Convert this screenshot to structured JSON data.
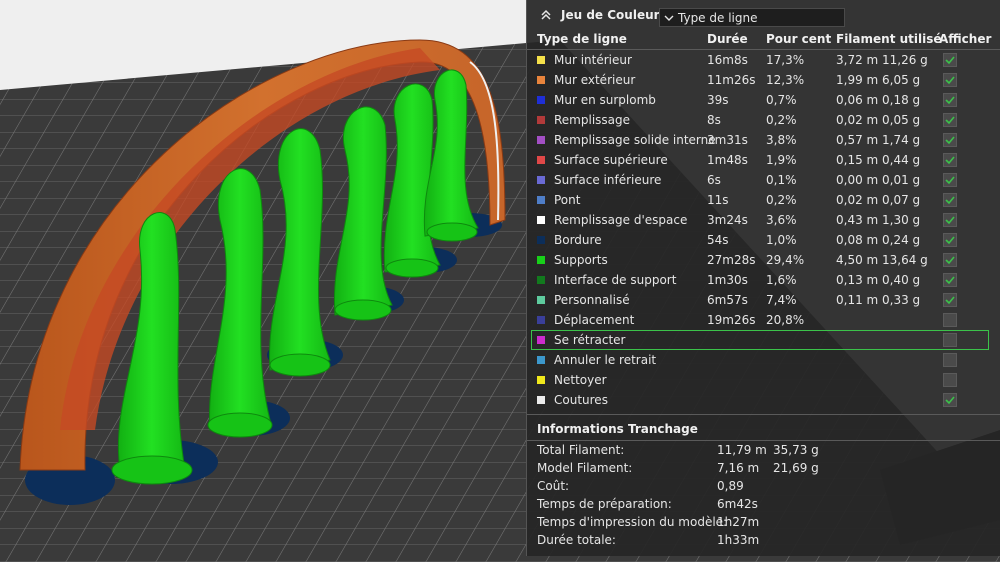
{
  "panel": {
    "title": "Jeu de Couleur",
    "select_value": "Type de ligne"
  },
  "columns": {
    "type": "Type de ligne",
    "duration": "Durée",
    "percent": "Pour cent",
    "filament": "Filament utilisé",
    "show": "Afficher"
  },
  "rows": [
    {
      "name": "Mur intérieur",
      "color": "#f5e04a",
      "duration": "16m8s",
      "percent": "17,3%",
      "length": "3,72 m",
      "weight": "11,26 g",
      "show": true
    },
    {
      "name": "Mur extérieur",
      "color": "#e8843c",
      "duration": "11m26s",
      "percent": "12,3%",
      "length": "1,99 m",
      "weight": "6,05 g",
      "show": true
    },
    {
      "name": "Mur en surplomb",
      "color": "#1f2fd6",
      "duration": "39s",
      "percent": "0,7%",
      "length": "0,06 m",
      "weight": "0,18 g",
      "show": true
    },
    {
      "name": "Remplissage",
      "color": "#b23a3a",
      "duration": "8s",
      "percent": "0,2%",
      "length": "0,02 m",
      "weight": "0,05 g",
      "show": true
    },
    {
      "name": "Remplissage solide interne",
      "color": "#a34fc4",
      "duration": "3m31s",
      "percent": "3,8%",
      "length": "0,57 m",
      "weight": "1,74 g",
      "show": true
    },
    {
      "name": "Surface supérieure",
      "color": "#e04848",
      "duration": "1m48s",
      "percent": "1,9%",
      "length": "0,15 m",
      "weight": "0,44 g",
      "show": true
    },
    {
      "name": "Surface inférieure",
      "color": "#6a6ad4",
      "duration": "6s",
      "percent": "0,1%",
      "length": "0,00 m",
      "weight": "0,01 g",
      "show": true
    },
    {
      "name": "Pont",
      "color": "#4f7ec8",
      "duration": "11s",
      "percent": "0,2%",
      "length": "0,02 m",
      "weight": "0,07 g",
      "show": true
    },
    {
      "name": "Remplissage d'espace",
      "color": "#ffffff",
      "duration": "3m24s",
      "percent": "3,6%",
      "length": "0,43 m",
      "weight": "1,30 g",
      "show": true
    },
    {
      "name": "Bordure",
      "color": "#0c2e5a",
      "duration": "54s",
      "percent": "1,0%",
      "length": "0,08 m",
      "weight": "0,24 g",
      "show": true
    },
    {
      "name": "Supports",
      "color": "#18d01a",
      "duration": "27m28s",
      "percent": "29,4%",
      "length": "4,50 m",
      "weight": "13,64 g",
      "show": true
    },
    {
      "name": "Interface de support",
      "color": "#127a1e",
      "duration": "1m30s",
      "percent": "1,6%",
      "length": "0,13 m",
      "weight": "0,40 g",
      "show": true
    },
    {
      "name": "Personnalisé",
      "color": "#5ecb9e",
      "duration": "6m57s",
      "percent": "7,4%",
      "length": "0,11 m",
      "weight": "0,33 g",
      "show": true
    },
    {
      "name": "Déplacement",
      "color": "#3a3f9a",
      "duration": "19m26s",
      "percent": "20,8%",
      "length": "",
      "weight": "",
      "show": false
    },
    {
      "name": "Se rétracter",
      "color": "#cc2ccc",
      "duration": "",
      "percent": "",
      "length": "",
      "weight": "",
      "show": false,
      "selected": true
    },
    {
      "name": "Annuler le retrait",
      "color": "#3c98cc",
      "duration": "",
      "percent": "",
      "length": "",
      "weight": "",
      "show": false
    },
    {
      "name": "Nettoyer",
      "color": "#f0e81c",
      "duration": "",
      "percent": "",
      "length": "",
      "weight": "",
      "show": false
    },
    {
      "name": "Coutures",
      "color": "#ececec",
      "duration": "",
      "percent": "",
      "length": "",
      "weight": "",
      "show": true
    }
  ],
  "info": {
    "title": "Informations Tranchage",
    "items": [
      {
        "label": "Total Filament:",
        "v1": "11,79 m",
        "v2": "35,73 g"
      },
      {
        "label": "Model Filament:",
        "v1": "7,16 m",
        "v2": "21,69 g"
      },
      {
        "label": "Coût:",
        "v1": "0,89",
        "v2": ""
      },
      {
        "label": "Temps de préparation:",
        "v1": "6m42s",
        "v2": ""
      },
      {
        "label": "Temps d'impression du modèle:",
        "v1": "1h27m",
        "v2": ""
      },
      {
        "label": "Durée totale:",
        "v1": "1h33m",
        "v2": ""
      }
    ]
  },
  "colors": {
    "check": "#3bc24a",
    "selected_outline": "#3bc24a",
    "panel_bg": "#262626"
  },
  "icons": {
    "collapse": "chevron-up-double-icon",
    "select": "chevron-down-icon",
    "check": "checkmark-icon"
  }
}
